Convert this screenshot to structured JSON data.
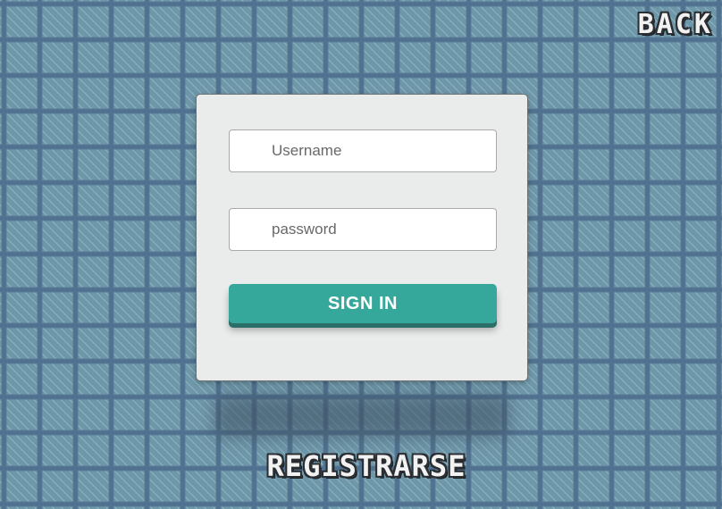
{
  "nav": {
    "back_label": "BACK"
  },
  "login": {
    "username_placeholder": "Username",
    "password_placeholder": "password",
    "signin_label": "SIGN IN"
  },
  "footer": {
    "register_label": "REGISTRARSE"
  },
  "theme": {
    "tile_color": "#6e97a9",
    "grid_line_color": "#50718f",
    "panel_color": "#eaebeb",
    "button_color": "#36a89b",
    "button_shadow_color": "#2b6f6a"
  }
}
